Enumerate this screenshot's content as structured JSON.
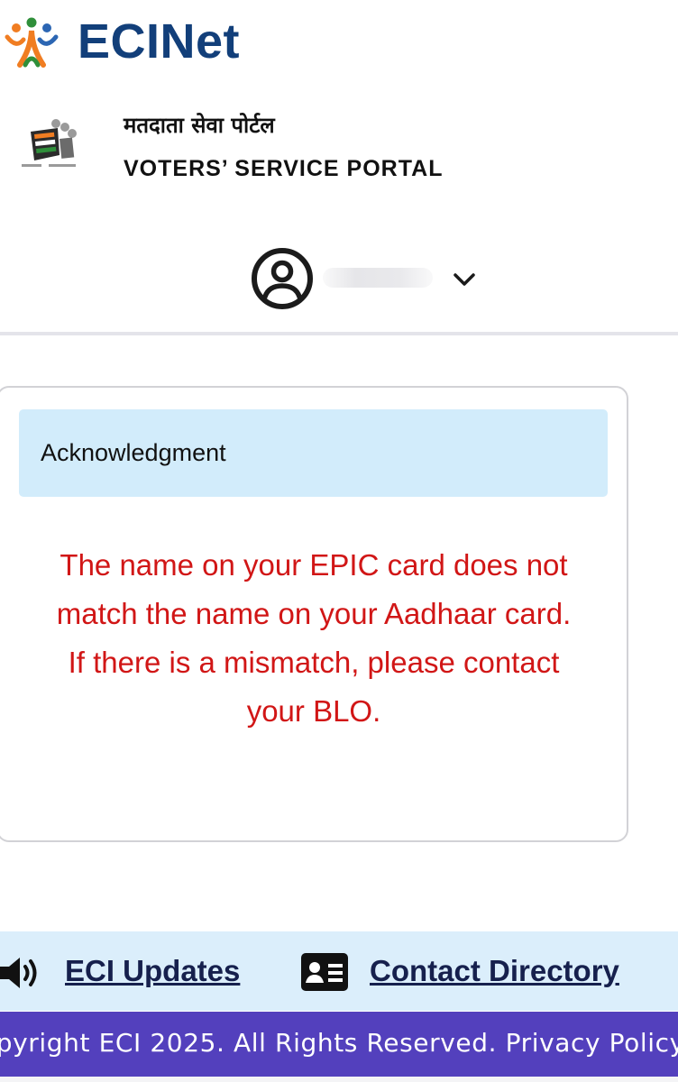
{
  "brand": {
    "name": "ECINet",
    "logo_icon": "eci-people-logo-icon"
  },
  "portal": {
    "emblem_icon": "eci-ballot-emblem-icon",
    "title_hi": "मतदाता सेवा पोर्टल",
    "title_en": "VOTERS’ SERVICE PORTAL"
  },
  "user_menu": {
    "avatar_icon": "user-circle-icon",
    "dropdown_icon": "chevron-down-icon"
  },
  "acknowledgment": {
    "title": "Acknowledgment",
    "message": "The name on your EPIC card does not match the name on your Aadhaar card. If there is a mismatch, please contact your BLO."
  },
  "footer": {
    "links": {
      "updates_icon": "speaker-icon",
      "updates_label": "ECI Updates",
      "directory_icon": "contact-card-icon",
      "directory_label": "Contact Directory"
    },
    "copyright": "opyright ECI 2025. All Rights Reserved.",
    "privacy_label": "Privacy Policy"
  },
  "colors": {
    "brand_blue": "#123f7a",
    "alert_red": "#d11616",
    "header_tint": "#d2ecfb",
    "footer_links_bg": "#dbeefb",
    "footer_purple": "#5340bd",
    "link_navy": "#16204d"
  }
}
